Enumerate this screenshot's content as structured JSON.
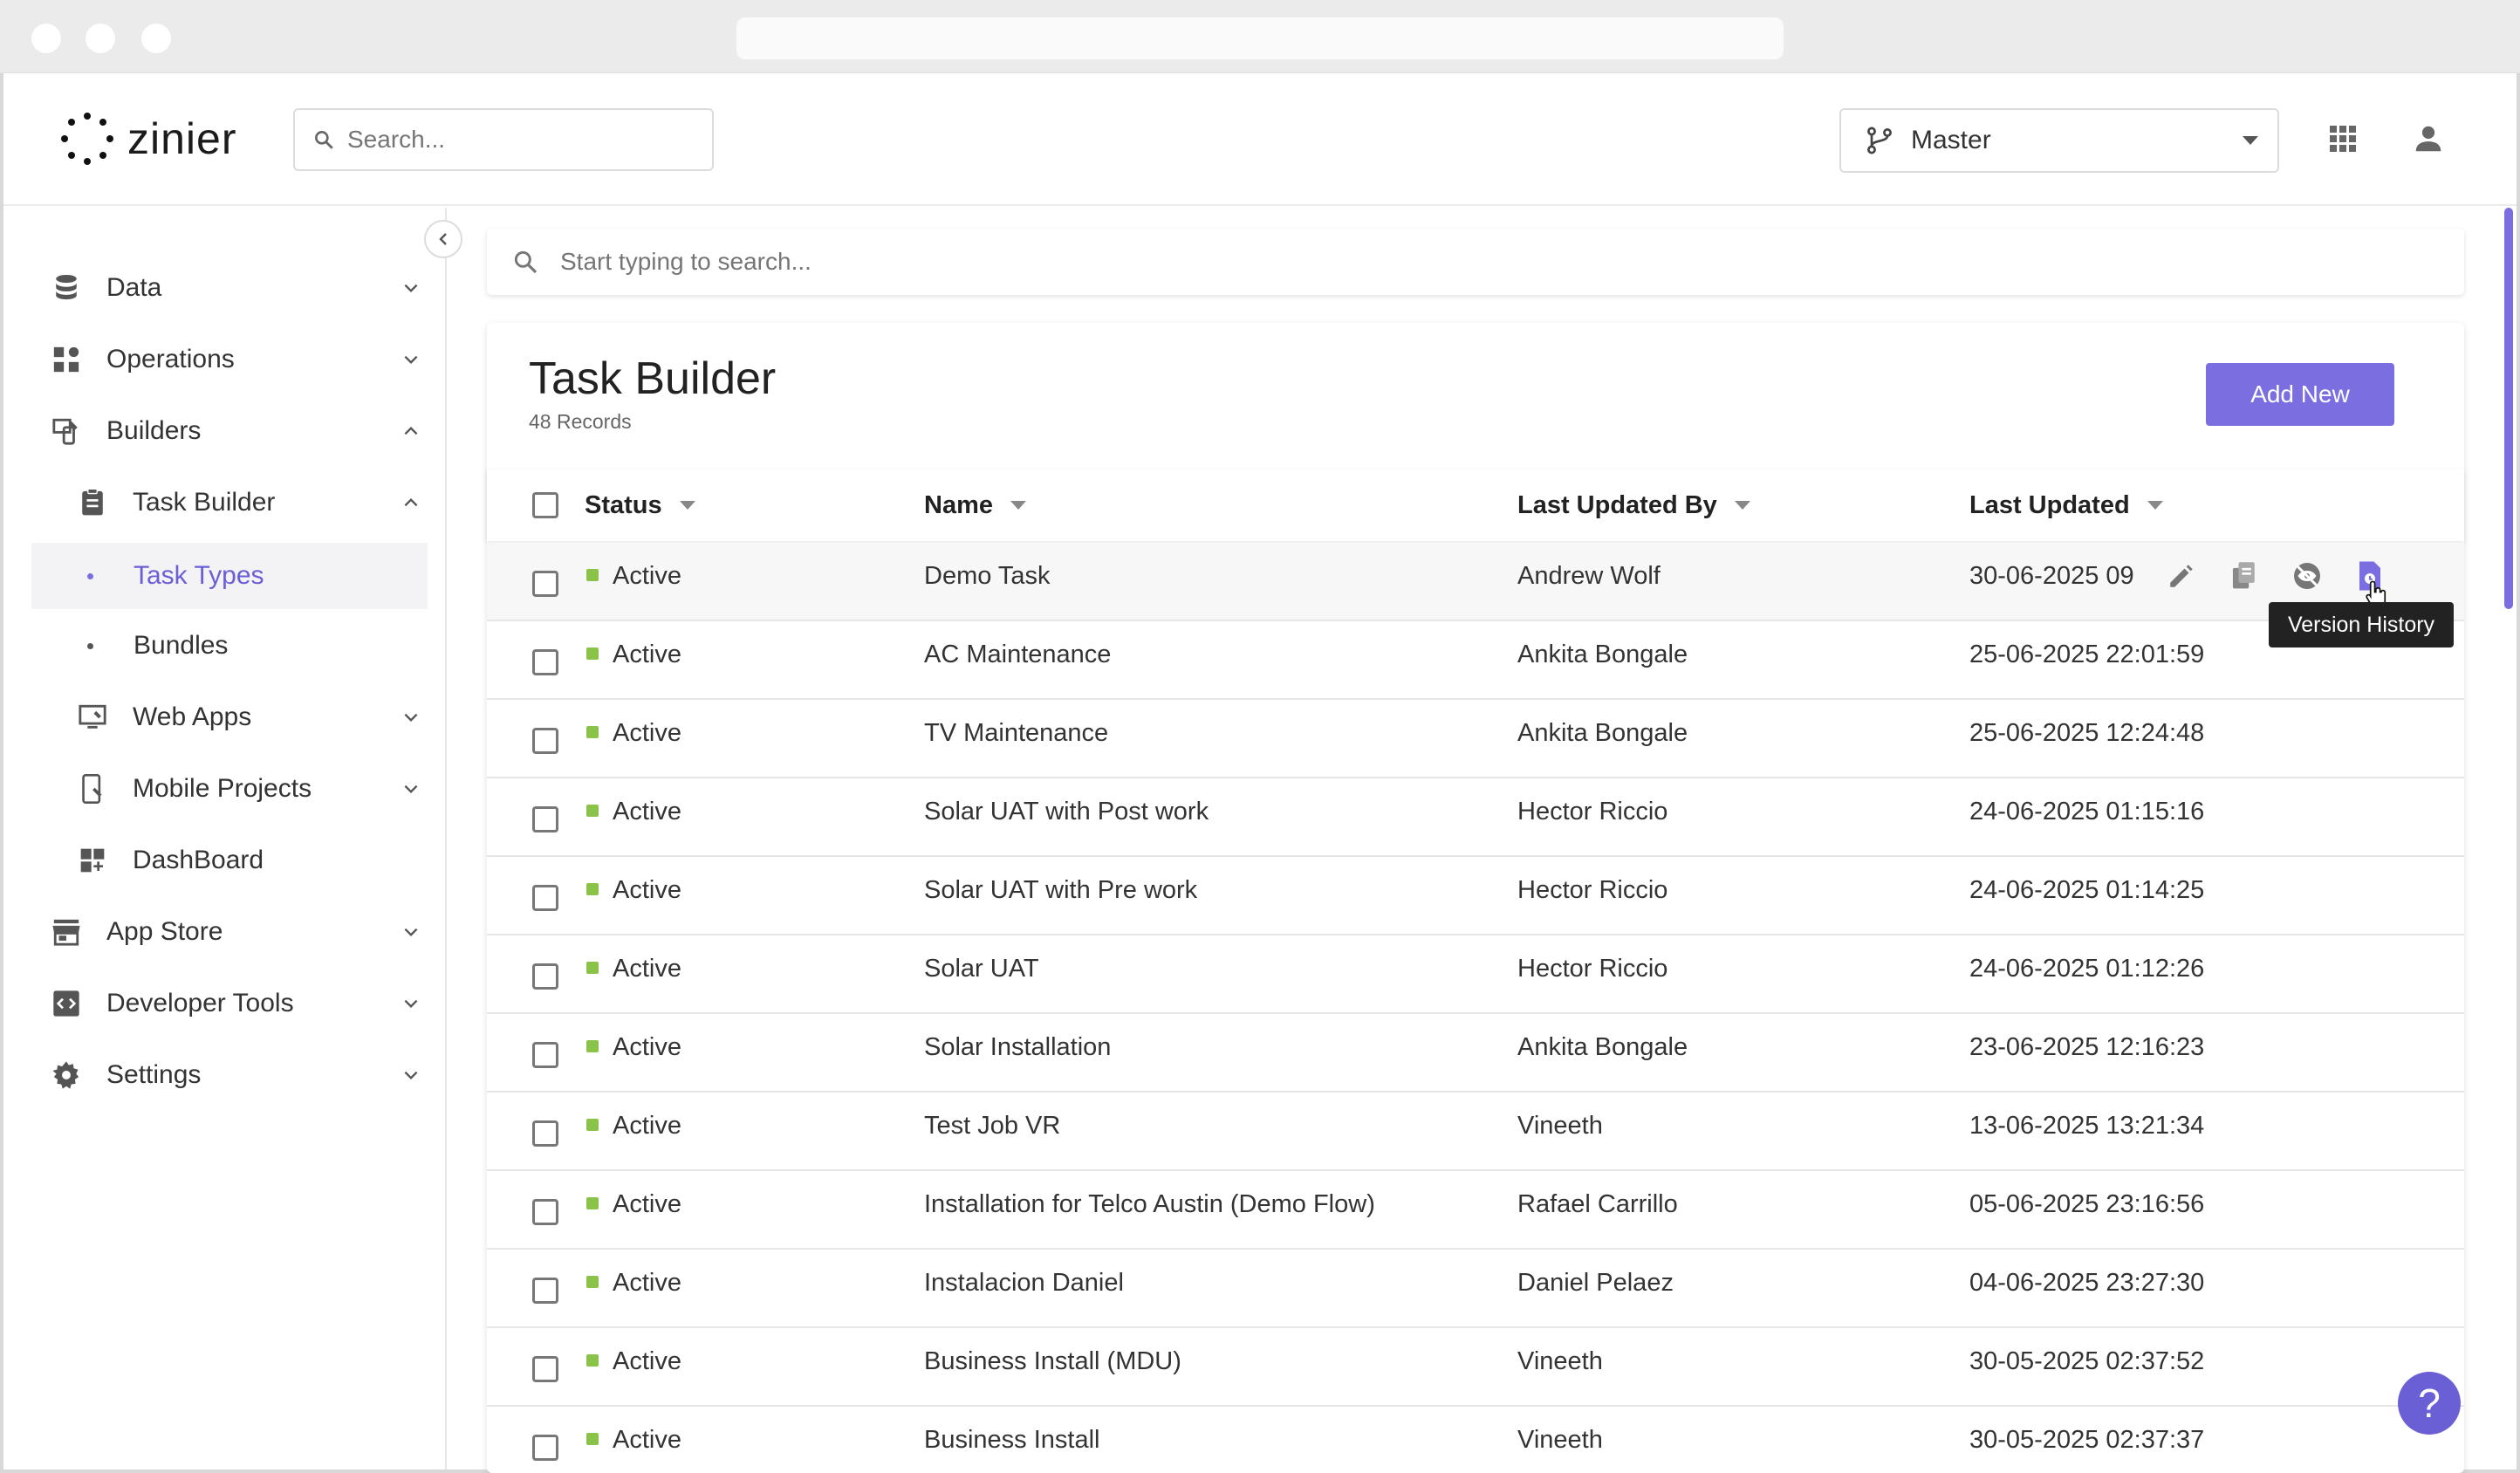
{
  "header": {
    "logo_text": "zinier",
    "search_placeholder": "Search...",
    "branch": "Master"
  },
  "sidebar": {
    "items": [
      {
        "label": "Data",
        "icon": "database-icon"
      },
      {
        "label": "Operations",
        "icon": "operations-icon"
      },
      {
        "label": "Builders",
        "icon": "builders-icon"
      },
      {
        "label": "Task Builder",
        "icon": "clipboard-icon"
      },
      {
        "label": "Task Types"
      },
      {
        "label": "Bundles"
      },
      {
        "label": "Web Apps",
        "icon": "monitor-icon"
      },
      {
        "label": "Mobile Projects",
        "icon": "mobile-icon"
      },
      {
        "label": "DashBoard",
        "icon": "dashboard-icon"
      },
      {
        "label": "App Store",
        "icon": "store-icon"
      },
      {
        "label": "Developer Tools",
        "icon": "code-icon"
      },
      {
        "label": "Settings",
        "icon": "gear-icon"
      }
    ]
  },
  "main": {
    "search_placeholder": "Start typing to search...",
    "title": "Task Builder",
    "records": "48 Records",
    "add_label": "Add New",
    "columns": [
      "Status",
      "Name",
      "Last Updated By",
      "Last Updated"
    ],
    "rows": [
      {
        "status": "Active",
        "name": "Demo Task",
        "by": "Andrew Wolf",
        "updated": "30-06-2025 09"
      },
      {
        "status": "Active",
        "name": "AC Maintenance",
        "by": "Ankita Bongale",
        "updated": "25-06-2025 22:01:59"
      },
      {
        "status": "Active",
        "name": "TV Maintenance",
        "by": "Ankita Bongale",
        "updated": "25-06-2025 12:24:48"
      },
      {
        "status": "Active",
        "name": "Solar UAT with Post work",
        "by": "Hector Riccio",
        "updated": "24-06-2025 01:15:16"
      },
      {
        "status": "Active",
        "name": "Solar UAT with Pre work",
        "by": "Hector Riccio",
        "updated": "24-06-2025 01:14:25"
      },
      {
        "status": "Active",
        "name": "Solar UAT",
        "by": "Hector Riccio",
        "updated": "24-06-2025 01:12:26"
      },
      {
        "status": "Active",
        "name": "Solar Installation",
        "by": "Ankita Bongale",
        "updated": "23-06-2025 12:16:23"
      },
      {
        "status": "Active",
        "name": "Test Job VR",
        "by": "Vineeth",
        "updated": "13-06-2025 13:21:34"
      },
      {
        "status": "Active",
        "name": "Installation for Telco Austin (Demo Flow)",
        "by": "Rafael Carrillo",
        "updated": "05-06-2025 23:16:56"
      },
      {
        "status": "Active",
        "name": "Instalacion Daniel",
        "by": "Daniel Pelaez",
        "updated": "04-06-2025 23:27:30"
      },
      {
        "status": "Active",
        "name": "Business Install (MDU)",
        "by": "Vineeth",
        "updated": "30-05-2025 02:37:52"
      },
      {
        "status": "Active",
        "name": "Business Install",
        "by": "Vineeth",
        "updated": "30-05-2025 02:37:37"
      }
    ],
    "tooltip": "Version History",
    "help": "?"
  },
  "colors": {
    "accent": "#7a6ee0",
    "active_status": "#8bc34a"
  }
}
